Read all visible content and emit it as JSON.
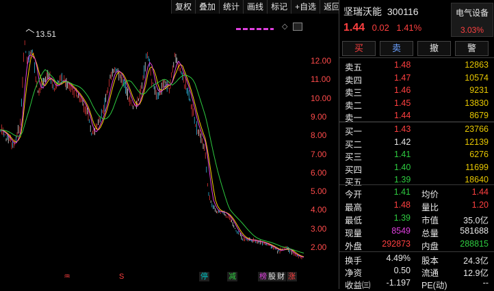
{
  "toolbar": [
    "复权",
    "叠加",
    "统计",
    "画线",
    "标记",
    "+自选",
    "返回"
  ],
  "chart": {
    "peak_label": "13.51",
    "y_ticks": [
      "12.00",
      "11.00",
      "10.00",
      "9.00",
      "8.00",
      "7.00",
      "6.00",
      "5.00",
      "4.00",
      "3.00",
      "2.00"
    ],
    "markers": [
      {
        "text": "♒",
        "color": "#ff4040"
      },
      {
        "text": "S",
        "color": "#ff4040"
      },
      {
        "text": "停",
        "color": "#00c0c0"
      },
      {
        "text": "减",
        "color": "#2ecc40"
      },
      {
        "text": "榜",
        "color": "#e040e0"
      },
      {
        "text": "股",
        "color": "#e8e8e8"
      },
      {
        "text": "财",
        "color": "#e8e8e8"
      },
      {
        "text": "涨",
        "color": "#ff4040"
      }
    ]
  },
  "stock": {
    "name": "坚瑞沃能",
    "code": "300116",
    "price": "1.44",
    "change": "0.02",
    "change_pct": "1.41%",
    "sector": "电气设备",
    "sector_pct": "3.03%"
  },
  "actions": [
    "买",
    "卖",
    "撤",
    "警"
  ],
  "sells": [
    {
      "label": "卖五",
      "price": "1.48",
      "vol": "12863",
      "color": "red"
    },
    {
      "label": "卖四",
      "price": "1.47",
      "vol": "10574",
      "color": "red"
    },
    {
      "label": "卖三",
      "price": "1.46",
      "vol": "9231",
      "color": "red"
    },
    {
      "label": "卖二",
      "price": "1.45",
      "vol": "13830",
      "color": "red"
    },
    {
      "label": "卖一",
      "price": "1.44",
      "vol": "8679",
      "color": "red"
    }
  ],
  "buys": [
    {
      "label": "买一",
      "price": "1.43",
      "vol": "23766",
      "color": "red"
    },
    {
      "label": "买二",
      "price": "1.42",
      "vol": "12139",
      "color": "white"
    },
    {
      "label": "买三",
      "price": "1.41",
      "vol": "6276",
      "color": "green"
    },
    {
      "label": "买四",
      "price": "1.40",
      "vol": "11699",
      "color": "green"
    },
    {
      "label": "买五",
      "price": "1.39",
      "vol": "18640",
      "color": "green"
    }
  ],
  "stats": [
    {
      "l1": "今开",
      "v1": "1.41",
      "c1": "green",
      "l2": "均价",
      "v2": "1.44",
      "c2": "red"
    },
    {
      "l1": "最高",
      "v1": "1.48",
      "c1": "red",
      "l2": "量比",
      "v2": "1.20",
      "c2": "red"
    },
    {
      "l1": "最低",
      "v1": "1.39",
      "c1": "green",
      "l2": "市值",
      "v2": "35.0亿",
      "c2": "white"
    },
    {
      "l1": "现量",
      "v1": "8549",
      "c1": "magenta",
      "l2": "总量",
      "v2": "581688",
      "c2": "white"
    },
    {
      "l1": "外盘",
      "v1": "292873",
      "c1": "red",
      "l2": "内盘",
      "v2": "288815",
      "c2": "green"
    }
  ],
  "fund": [
    {
      "l1": "换手",
      "v1": "4.49%",
      "l2": "股本",
      "v2": "24.3亿"
    },
    {
      "l1": "净资",
      "v1": "0.50",
      "l2": "流通",
      "v2": "12.9亿"
    },
    {
      "l1": "收益㈢",
      "v1": "-1.197",
      "l2": "PE(动)",
      "v2": "--"
    }
  ]
}
